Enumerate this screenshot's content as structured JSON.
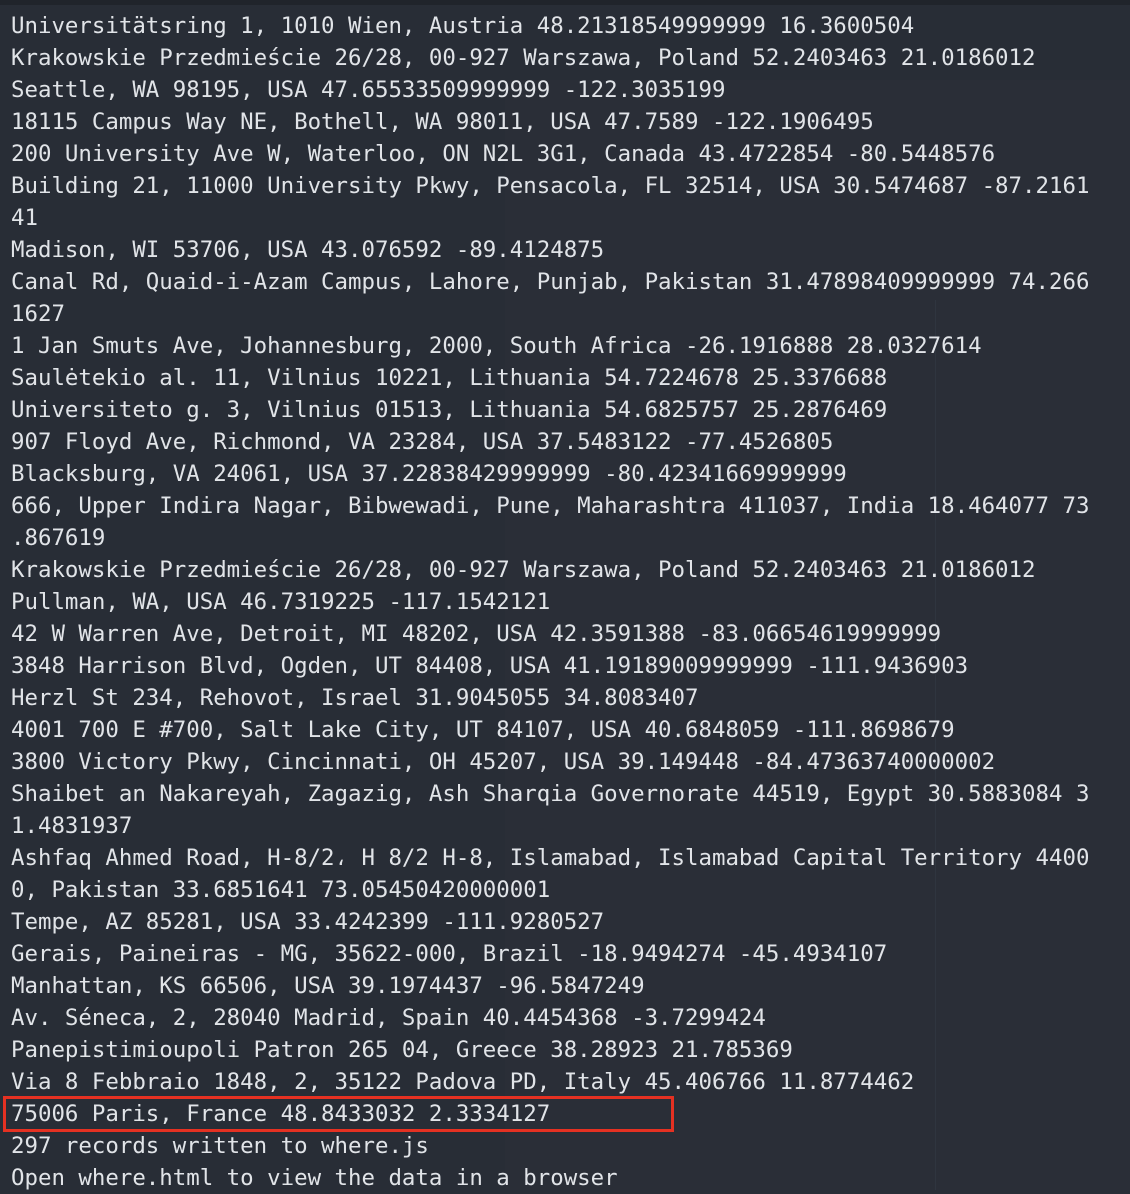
{
  "terminal": {
    "lines": [
      "Universitätsring 1, 1010 Wien, Austria 48.21318549999999 16.3600504",
      "Krakowskie Przedmieście 26/28, 00-927 Warszawa, Poland 52.2403463 21.0186012",
      "Seattle, WA 98195, USA 47.65533509999999 -122.3035199",
      "18115 Campus Way NE, Bothell, WA 98011, USA 47.7589 -122.1906495",
      "200 University Ave W, Waterloo, ON N2L 3G1, Canada 43.4722854 -80.5448576",
      "Building 21, 11000 University Pkwy, Pensacola, FL 32514, USA 30.5474687 -87.2161",
      "41",
      "Madison, WI 53706, USA 43.076592 -89.4124875",
      "Canal Rd, Quaid-i-Azam Campus, Lahore, Punjab, Pakistan 31.47898409999999 74.266",
      "1627",
      "1 Jan Smuts Ave, Johannesburg, 2000, South Africa -26.1916888 28.0327614",
      "Saulėtekio al. 11, Vilnius 10221, Lithuania 54.7224678 25.3376688",
      "Universiteto g. 3, Vilnius 01513, Lithuania 54.6825757 25.2876469",
      "907 Floyd Ave, Richmond, VA 23284, USA 37.5483122 -77.4526805",
      "Blacksburg, VA 24061, USA 37.22838429999999 -80.42341669999999",
      "666, Upper Indira Nagar, Bibwewadi, Pune, Maharashtra 411037, India 18.464077 73",
      ".867619",
      "Krakowskie Przedmieście 26/28, 00-927 Warszawa, Poland 52.2403463 21.0186012",
      "Pullman, WA, USA 46.7319225 -117.1542121",
      "42 W Warren Ave, Detroit, MI 48202, USA 42.3591388 -83.06654619999999",
      "3848 Harrison Blvd, Ogden, UT 84408, USA 41.19189009999999 -111.9436903",
      "Herzl St 234, Rehovot, Israel 31.9045055 34.8083407",
      "4001 700 E #700, Salt Lake City, UT 84107, USA 40.6848059 -111.8698679",
      "3800 Victory Pkwy, Cincinnati, OH 45207, USA 39.149448 -84.47363740000002",
      "Shaibet an Nakareyah, Zagazig, Ash Sharqia Governorate 44519, Egypt 30.5883084 3",
      "1.4831937",
      "Ashfaq Ahmed Road, H-8/2، H 8/2 H-8, Islamabad, Islamabad Capital Territory 4400",
      "0, Pakistan 33.6851641 73.05450420000001",
      "Tempe, AZ 85281, USA 33.4242399 -111.9280527",
      "Gerais, Paineiras - MG, 35622-000, Brazil -18.9494274 -45.4934107",
      "Manhattan, KS 66506, USA 39.1974437 -96.5847249",
      "Av. Séneca, 2, 28040 Madrid, Spain 40.4454368 -3.7299424",
      "Panepistimioupoli Patron 265 04, Greece 38.28923 21.785369",
      "Via 8 Febbraio 1848, 2, 35122 Padova PD, Italy 45.406766 11.8774462",
      "75006 Paris, France 48.8433032 2.3334127",
      "297 records written to where.js",
      "Open where.html to view the data in a browser"
    ]
  },
  "colors": {
    "background": "#282d36",
    "text": "#e1e4e8",
    "highlight": "#e53122"
  }
}
